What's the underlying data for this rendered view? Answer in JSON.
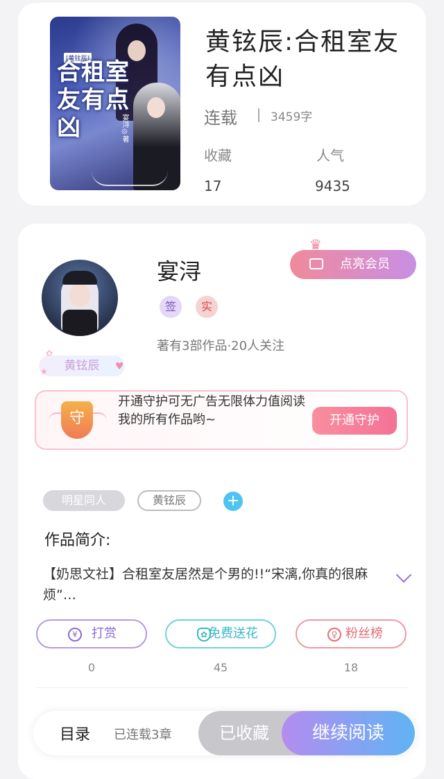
{
  "book": {
    "title": "黄铉辰:合租室友有点凶",
    "status": "连载",
    "word_count": "3459字",
    "stats": [
      {
        "label": "收藏",
        "value": "17"
      },
      {
        "label": "人气",
        "value": "9435"
      }
    ],
    "cover": {
      "tag": "[黄铉辰]",
      "title": "合租室友有点凶",
      "author": "宴浔◎著"
    }
  },
  "author": {
    "name": "宴浔",
    "badges": [
      "签",
      "实"
    ],
    "works_info": "著有3部作品·20人关注",
    "fan_badge": "黄铉辰",
    "vip_button": "点亮会员"
  },
  "guard": {
    "shield_char": "守",
    "text": "开通守护可无广告无限体力值阅读我的所有作品哟~",
    "button": "开通守护"
  },
  "tags": [
    "明星同人",
    "黄铉辰"
  ],
  "add_tag": "+",
  "intro": {
    "heading": "作品简介:",
    "text": "【奶思文社】合租室友居然是个男的!!“宋漓,你真的很麻烦”…"
  },
  "actions": [
    {
      "label": "打赏",
      "icon": "¥",
      "count": "0"
    },
    {
      "label": "免费送花",
      "icon": "✿",
      "count": "45"
    },
    {
      "label": "粉丝榜",
      "icon": "♀",
      "count": "18"
    }
  ],
  "bottom_bar": {
    "toc": "目录",
    "chapters": "已连载3章",
    "collected": "已收藏",
    "read": "继续阅读"
  }
}
